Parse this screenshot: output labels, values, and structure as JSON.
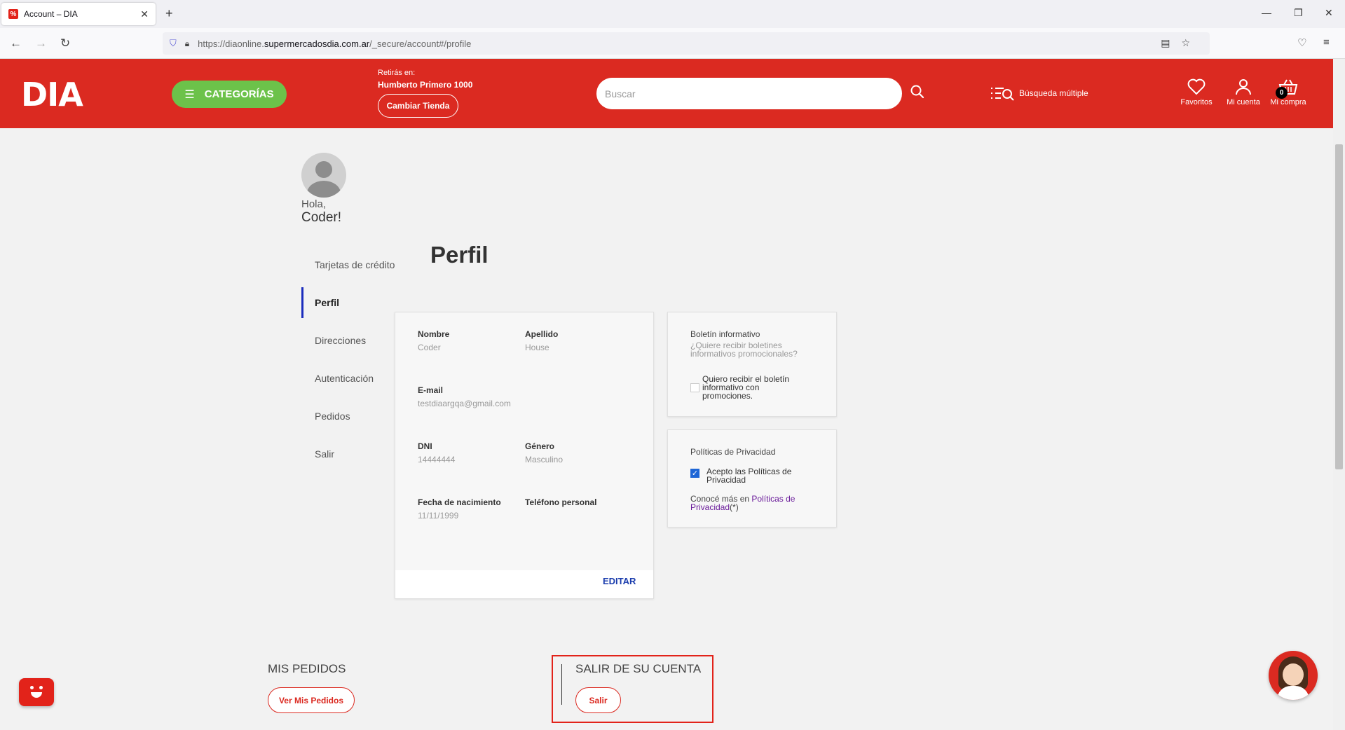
{
  "browser": {
    "tab_title": "Account – DIA",
    "url_prefix": "https://diaonline.",
    "url_host": "supermercadosdia.com.ar",
    "url_path": "/_secure/account#/profile"
  },
  "header": {
    "logo": "DIA",
    "categories_label": "CATEGORÍAS",
    "store_label": "Retirás en:",
    "store_name": "Humberto Primero 1000",
    "change_store_label": "Cambiar Tienda",
    "search_placeholder": "Buscar",
    "multi_search_label": "Búsqueda múltiple",
    "favorites_label": "Favoritos",
    "account_label": "Mi cuenta",
    "cart_label": "Mi compra",
    "cart_count": "0"
  },
  "profile": {
    "greeting": "Hola,",
    "user_name": "Coder!",
    "page_title": "Perfil"
  },
  "sidebar": {
    "items": [
      {
        "label": "Tarjetas de crédito"
      },
      {
        "label": "Perfil"
      },
      {
        "label": "Direcciones"
      },
      {
        "label": "Autenticación"
      },
      {
        "label": "Pedidos"
      },
      {
        "label": "Salir"
      }
    ],
    "active_index": 1
  },
  "fields": {
    "nombre_label": "Nombre",
    "nombre_value": "Coder",
    "apellido_label": "Apellido",
    "apellido_value": "House",
    "email_label": "E-mail",
    "email_value": "testdiaargqa@gmail.com",
    "dni_label": "DNI",
    "dni_value": "14444444",
    "genero_label": "Género",
    "genero_value": "Masculino",
    "nacimiento_label": "Fecha de nacimiento",
    "nacimiento_value": "11/11/1999",
    "telefono_label": "Teléfono personal",
    "editar_label": "EDITAR"
  },
  "newsletter": {
    "title": "Boletín informativo",
    "subtitle": "¿Quiere recibir boletines informativos promocionales?",
    "checkbox_label": "Quiero recibir el boletín informativo con promociones.",
    "checked": false
  },
  "privacy": {
    "title": "Políticas de Privacidad",
    "checkbox_label": "Acepto las Políticas de Privacidad",
    "checked": true,
    "more_prefix": "Conocé más en ",
    "more_link": "Políticas de Privacidad",
    "more_suffix": "(*)"
  },
  "bottom": {
    "orders_title": "MIS PEDIDOS",
    "orders_button": "Ver Mis Pedidos",
    "logout_title": "SALIR DE SU CUENTA",
    "logout_button": "Salir"
  },
  "colors": {
    "brand_red": "#db2a21",
    "category_green": "#6cc24a",
    "active_nav": "#1b2dbd"
  }
}
